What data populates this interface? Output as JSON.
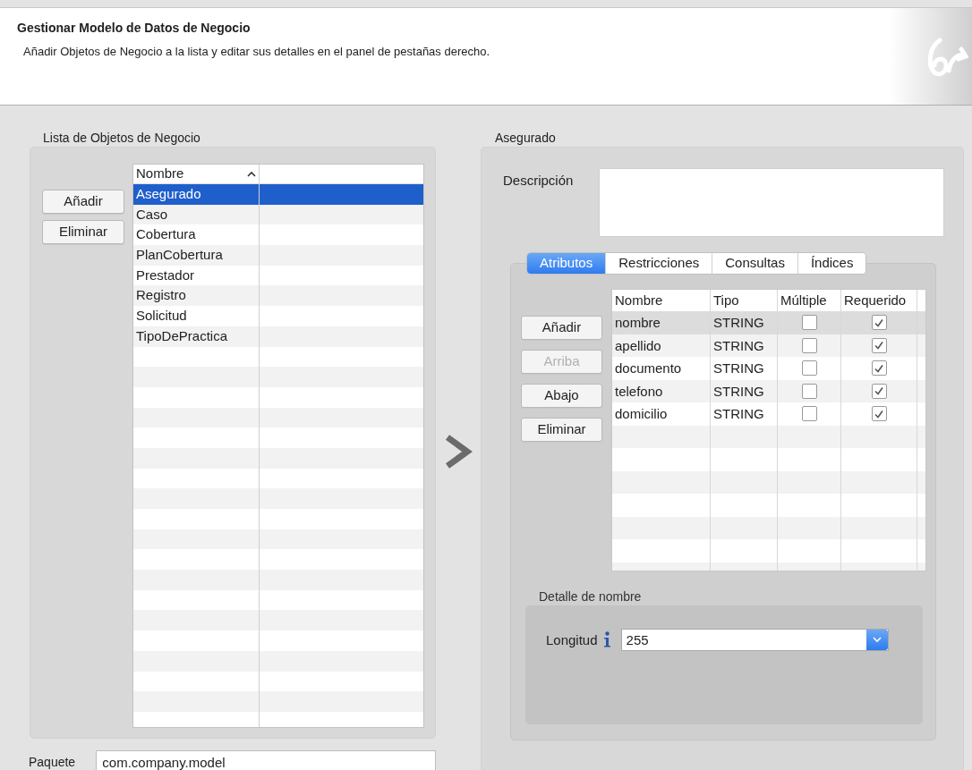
{
  "header": {
    "title": "Gestionar Modelo de Datos de Negocio",
    "subtitle": "Añadir Objetos de Negocio a la lista y editar sus detalles en el panel de pestañas derecho."
  },
  "left": {
    "title": "Lista de Objetos de Negocio",
    "buttons": [
      {
        "label": "Añadir",
        "disabled": false
      },
      {
        "label": "Eliminar",
        "disabled": false
      }
    ],
    "list": {
      "column": "Nombre",
      "items": [
        {
          "name": "Asegurado",
          "selected": true
        },
        {
          "name": "Caso",
          "selected": false
        },
        {
          "name": "Cobertura",
          "selected": false
        },
        {
          "name": "PlanCobertura",
          "selected": false
        },
        {
          "name": "Prestador",
          "selected": false
        },
        {
          "name": "Registro",
          "selected": false
        },
        {
          "name": "Solicitud",
          "selected": false
        },
        {
          "name": "TipoDePractica",
          "selected": false
        }
      ]
    },
    "package": {
      "label": "Paquete",
      "value": "com.company.model"
    }
  },
  "right": {
    "title": "Asegurado",
    "description": {
      "label": "Descripción"
    },
    "tabs": [
      {
        "label": "Atributos",
        "selected": true
      },
      {
        "label": "Restricciones",
        "selected": false
      },
      {
        "label": "Consultas",
        "selected": false
      },
      {
        "label": "Índices",
        "selected": false
      }
    ],
    "buttons": [
      {
        "label": "Añadir",
        "disabled": false
      },
      {
        "label": "Arriba",
        "disabled": true
      },
      {
        "label": "Abajo",
        "disabled": false
      },
      {
        "label": "Eliminar",
        "disabled": false
      }
    ],
    "table": {
      "columns": [
        "Nombre",
        "Tipo",
        "Múltiple",
        "Requerido"
      ],
      "rows": [
        {
          "nombre": "nombre",
          "tipo": "STRING",
          "multiple": false,
          "requerido": true,
          "selected": true
        },
        {
          "nombre": "apellido",
          "tipo": "STRING",
          "multiple": false,
          "requerido": true,
          "selected": false
        },
        {
          "nombre": "documento",
          "tipo": "STRING",
          "multiple": false,
          "requerido": true,
          "selected": false
        },
        {
          "nombre": "telefono",
          "tipo": "STRING",
          "multiple": false,
          "requerido": true,
          "selected": false
        },
        {
          "nombre": "domicilio",
          "tipo": "STRING",
          "multiple": false,
          "requerido": true,
          "selected": false
        }
      ]
    },
    "detail": {
      "title": "Detalle de nombre",
      "label": "Longitud",
      "value": "255"
    }
  }
}
